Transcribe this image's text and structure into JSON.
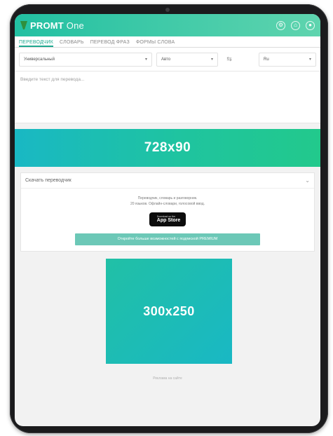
{
  "app": {
    "title_bold": "PROMT",
    "title_light": "One",
    "title_icons": [
      "settings-icon",
      "home-icon",
      "account-icon"
    ]
  },
  "tabs": [
    {
      "label": "ПЕРЕВОДЧИК",
      "active": true
    },
    {
      "label": "СЛОВАРЬ",
      "active": false
    },
    {
      "label": "ПЕРЕВОД ФРАЗ",
      "active": false
    },
    {
      "label": "ФОРМЫ СЛОВА",
      "active": false
    }
  ],
  "controls": {
    "topic": "Универсальный",
    "source_lang": "Авто",
    "target_lang": "Ru"
  },
  "input": {
    "placeholder": "Введите текст для перевода..."
  },
  "ads": {
    "banner_label": "728x90",
    "square_label": "300x250"
  },
  "download_card": {
    "header": "Скачать переводчик",
    "promo_line1": "Переводчик, словарь и разговорник.",
    "promo_line2": "20 языков. Офлайн-словари, голосовой ввод.",
    "appstore_small": "Download on the",
    "appstore_big": "App Store",
    "premium_button": "Откройте больше возможностей с подпиской PREMIUM"
  },
  "footer": {
    "note": "Реклама на сайте"
  },
  "colors": {
    "accent": "#1ea98f",
    "titlebar_start": "#22c0a2",
    "titlebar_end": "#5fd4ae",
    "premium": "#6cc8b7"
  }
}
